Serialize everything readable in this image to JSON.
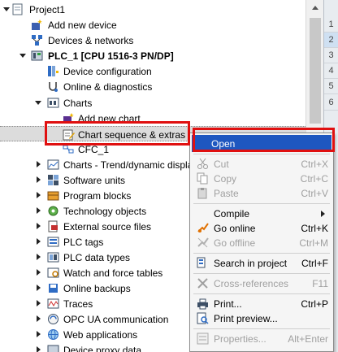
{
  "tree": {
    "project_label": "Project1",
    "add_device_label": "Add new device",
    "devices_networks_label": "Devices & networks",
    "plc_label": "PLC_1 [CPU 1516-3 PN/DP]",
    "device_config_label": "Device configuration",
    "online_diag_label": "Online & diagnostics",
    "charts_label": "Charts",
    "add_chart_label": "Add new chart",
    "chart_seq_label": "Chart sequence & extras",
    "cfc_label": "CFC_1",
    "charts_trend_label": "Charts - Trend/dynamic displa",
    "software_units_label": "Software units",
    "program_blocks_label": "Program blocks",
    "tech_objects_label": "Technology objects",
    "ext_source_label": "External source files",
    "plc_tags_label": "PLC tags",
    "plc_data_types_label": "PLC data types",
    "watch_force_label": "Watch and force tables",
    "online_backups_label": "Online backups",
    "traces_label": "Traces",
    "opc_ua_label": "OPC UA communication",
    "web_apps_label": "Web applications",
    "device_proxy_label": "Device proxy data"
  },
  "right_strip": {
    "numbers": [
      "1",
      "2",
      "3",
      "4",
      "5",
      "6"
    ]
  },
  "context_menu": {
    "open": {
      "label": "Open",
      "shortcut": ""
    },
    "cut": {
      "label": "Cut",
      "shortcut": "Ctrl+X"
    },
    "copy": {
      "label": "Copy",
      "shortcut": "Ctrl+C"
    },
    "paste": {
      "label": "Paste",
      "shortcut": "Ctrl+V"
    },
    "compile": {
      "label": "Compile",
      "shortcut": ""
    },
    "go_online": {
      "label": "Go online",
      "shortcut": "Ctrl+K"
    },
    "go_offline": {
      "label": "Go offline",
      "shortcut": "Ctrl+M"
    },
    "search_project": {
      "label": "Search in project",
      "shortcut": "Ctrl+F"
    },
    "cross_refs": {
      "label": "Cross-references",
      "shortcut": "F11"
    },
    "print": {
      "label": "Print...",
      "shortcut": "Ctrl+P"
    },
    "print_preview": {
      "label": "Print preview...",
      "shortcut": ""
    },
    "properties": {
      "label": "Properties...",
      "shortcut": "Alt+Enter"
    }
  },
  "colors": {
    "highlight_red": "#e01010",
    "menu_active": "#1e57c0",
    "selection_gray": "#dcdcdc"
  }
}
